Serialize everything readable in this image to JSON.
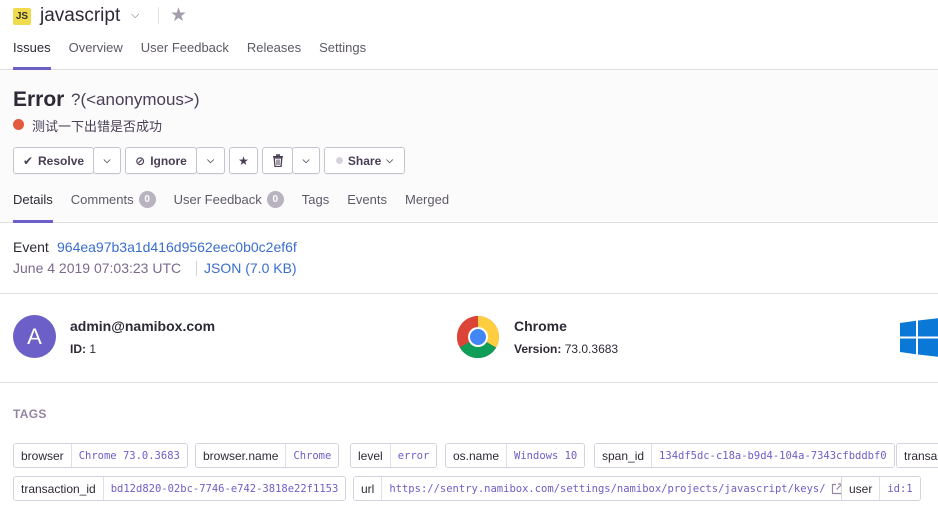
{
  "project": {
    "badge": "JS",
    "name": "javascript",
    "nav": [
      {
        "label": "Issues",
        "active": true
      },
      {
        "label": "Overview",
        "active": false
      },
      {
        "label": "User Feedback",
        "active": false
      },
      {
        "label": "Releases",
        "active": false
      },
      {
        "label": "Settings",
        "active": false
      }
    ]
  },
  "issue": {
    "title": "Error",
    "culprit": "?(<anonymous>)",
    "message": "测试一下出错是否成功",
    "level_color": "#e35a3e",
    "actions": {
      "resolve": "Resolve",
      "ignore": "Ignore",
      "share": "Share"
    },
    "tabs": [
      {
        "label": "Details",
        "active": true
      },
      {
        "label": "Comments",
        "count": "0"
      },
      {
        "label": "User Feedback",
        "count": "0"
      },
      {
        "label": "Tags"
      },
      {
        "label": "Events"
      },
      {
        "label": "Merged"
      }
    ]
  },
  "event": {
    "label": "Event",
    "id": "964ea97b3a1d416d9562eec0b0c2ef6f",
    "date": "June 4 2019 07:03:23 UTC",
    "json_link": "JSON (7.0 KB)"
  },
  "context": {
    "user": {
      "avatar_letter": "A",
      "name": "admin@namibox.com",
      "sub_label": "ID:",
      "sub_value": "1"
    },
    "browser": {
      "name": "Chrome",
      "sub_label": "Version:",
      "sub_value": "73.0.3683"
    },
    "os": {
      "icon": "windows-logo-icon"
    }
  },
  "tags": {
    "heading": "TAGS",
    "row1": [
      {
        "key": "browser",
        "value": "Chrome 73.0.3683"
      },
      {
        "key": "browser.name",
        "value": "Chrome"
      },
      {
        "key": "level",
        "value": "error"
      },
      {
        "key": "os.name",
        "value": "Windows 10"
      },
      {
        "key": "span_id",
        "value": "134df5dc-c18a-b9d4-104a-7343cfbddbf0"
      },
      {
        "key": "transa",
        "value": ""
      }
    ],
    "row2": [
      {
        "key": "transaction_id",
        "value": "bd12d820-02bc-7746-e742-3818e22f1153"
      },
      {
        "key": "url",
        "value": "https://sentry.namibox.com/settings/namibox/projects/javascript/keys/"
      },
      {
        "key": "user",
        "value": "id:1"
      }
    ]
  },
  "colors": {
    "accent": "#6c5fc7",
    "link": "#3b6ecc",
    "error": "#e35a3e"
  }
}
